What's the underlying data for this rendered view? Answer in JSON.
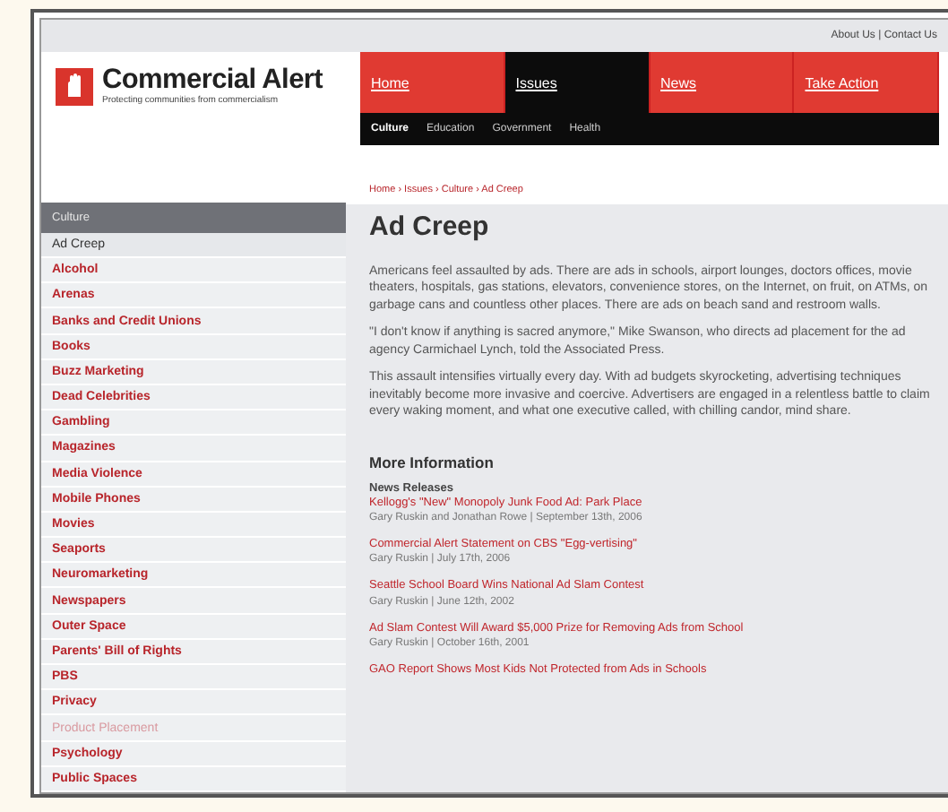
{
  "top_links": [
    "About Us | Contact Us"
  ],
  "logo": {
    "name": "Commercial Alert",
    "tagline": "Protecting communities from commercialism"
  },
  "nav": [
    {
      "label": "Home",
      "selected": false
    },
    {
      "label": "Issues",
      "selected": true
    },
    {
      "label": "News",
      "selected": false
    },
    {
      "label": "Take Action",
      "selected": false
    }
  ],
  "subnav": [
    {
      "label": "Culture",
      "selected": true
    },
    {
      "label": "Education",
      "selected": false
    },
    {
      "label": "Government",
      "selected": false
    },
    {
      "label": "Health",
      "selected": false
    }
  ],
  "breadcrumb": "Home › Issues › Culture › Ad Creep",
  "sidebar": {
    "heading": "Culture",
    "items": [
      {
        "label": "Ad Creep",
        "selected": true,
        "visited": false
      },
      {
        "label": "Alcohol",
        "selected": false,
        "visited": false
      },
      {
        "label": "Arenas",
        "selected": false,
        "visited": false
      },
      {
        "label": "Banks and Credit Unions",
        "selected": false,
        "visited": false
      },
      {
        "label": "Books",
        "selected": false,
        "visited": false
      },
      {
        "label": "Buzz Marketing",
        "selected": false,
        "visited": false
      },
      {
        "label": "Dead Celebrities",
        "selected": false,
        "visited": false
      },
      {
        "label": "Gambling",
        "selected": false,
        "visited": false
      },
      {
        "label": "Magazines",
        "selected": false,
        "visited": false
      },
      {
        "label": "Media Violence",
        "selected": false,
        "visited": false
      },
      {
        "label": "Mobile Phones",
        "selected": false,
        "visited": false
      },
      {
        "label": "Movies",
        "selected": false,
        "visited": false
      },
      {
        "label": "Seaports",
        "selected": false,
        "visited": false
      },
      {
        "label": "Neuromarketing",
        "selected": false,
        "visited": false
      },
      {
        "label": "Newspapers",
        "selected": false,
        "visited": false
      },
      {
        "label": "Outer Space",
        "selected": false,
        "visited": false
      },
      {
        "label": "Parents' Bill of Rights",
        "selected": false,
        "visited": false
      },
      {
        "label": "PBS",
        "selected": false,
        "visited": false
      },
      {
        "label": "Privacy",
        "selected": false,
        "visited": false
      },
      {
        "label": "Product Placement",
        "selected": false,
        "visited": true
      },
      {
        "label": "Psychology",
        "selected": false,
        "visited": false
      },
      {
        "label": "Public Spaces",
        "selected": false,
        "visited": false
      }
    ]
  },
  "article": {
    "title": "Ad Creep",
    "paragraphs": [
      "Americans feel assaulted by ads. There are ads in schools, airport lounges, doctors offices, movie theaters, hospitals, gas stations, elevators, convenience stores, on the Internet, on fruit, on ATMs, on garbage cans and countless other places. There are ads on beach sand and restroom walls.",
      "\"I don't know if anything is sacred anymore,\" Mike Swanson, who directs ad placement for the ad agency Carmichael Lynch, told the Associated Press.",
      "This assault intensifies virtually every day. With ad budgets skyrocketing, advertising techniques inevitably become more invasive and coercive. Advertisers are engaged in a relentless battle to claim every waking moment, and what one executive called, with chilling candor, mind share."
    ]
  },
  "more_information": {
    "heading": "More Information",
    "subheading": "News Releases",
    "items": [
      {
        "title": "Kellogg's \"New\" Monopoly Junk Food Ad: Park Place",
        "meta": "Gary Ruskin and Jonathan Rowe | September 13th, 2006"
      },
      {
        "title": "Commercial Alert Statement on CBS \"Egg-vertising\"",
        "meta": "Gary Ruskin | July 17th, 2006"
      },
      {
        "title": "Seattle School Board Wins National Ad Slam Contest",
        "meta": "Gary Ruskin | June 12th, 2002"
      },
      {
        "title": "Ad Slam Contest Will Award $5,000 Prize for Removing Ads from School",
        "meta": "Gary Ruskin | October 16th, 2001"
      },
      {
        "title": "GAO Report Shows Most Kids Not Protected from Ads in Schools"
      }
    ]
  }
}
